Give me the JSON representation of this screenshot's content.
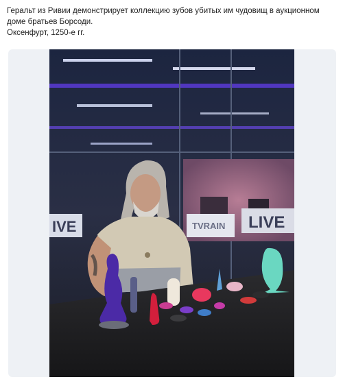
{
  "post": {
    "text_lines": [
      "Геральт из Ривии демонстрирует коллекцию зубов убитых им чудовищ в аукционном",
      "доме братьев Борсоди.",
      "Оксенфурт, 1250-е гг."
    ]
  },
  "photo": {
    "signage": [
      "IVE",
      "TVRAIN",
      "LIVE"
    ]
  }
}
